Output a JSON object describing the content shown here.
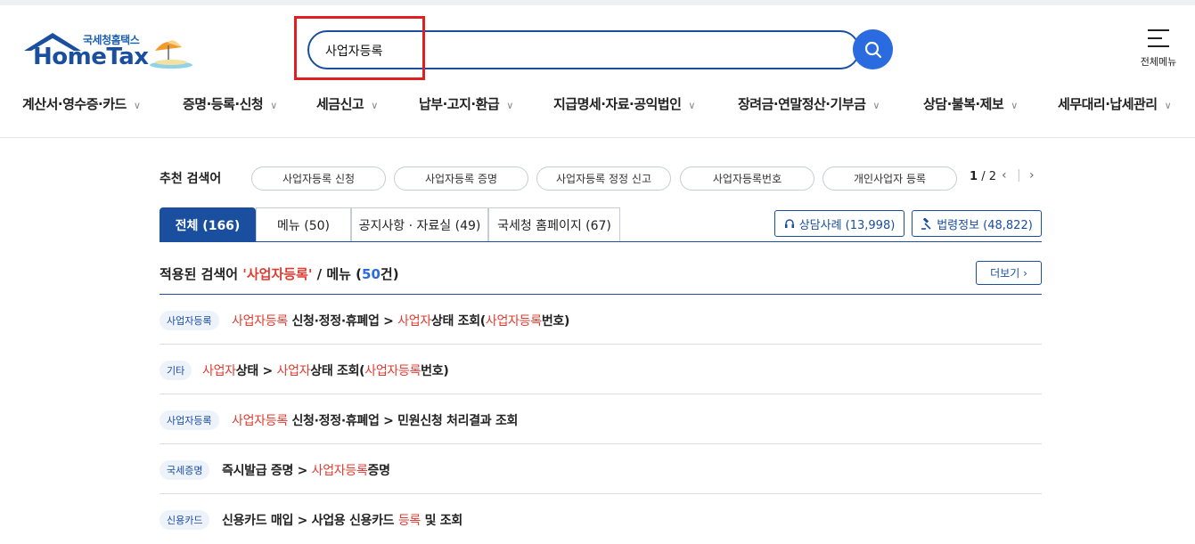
{
  "header": {
    "logo_sub": "국세청홈택스",
    "logo_main": "HomeTax",
    "search_value": "사업자등록",
    "all_menu_label": "전체메뉴"
  },
  "nav": [
    {
      "label": "계산서·영수증·카드"
    },
    {
      "label": "증명·등록·신청"
    },
    {
      "label": "세금신고"
    },
    {
      "label": "납부·고지·환급"
    },
    {
      "label": "지급명세·자료·공익법인"
    },
    {
      "label": "장려금·연말정산·기부금"
    },
    {
      "label": "상담·불복·제보"
    },
    {
      "label": "세무대리·납세관리"
    }
  ],
  "recommend": {
    "label": "추천 검색어",
    "chips": [
      "사업자등록 신청",
      "사업자등록 증명",
      "사업자등록 정정 신고",
      "사업자등록번호",
      "개인사업자 등록"
    ],
    "page_current": "1",
    "page_total": "/ 2"
  },
  "tabs": [
    {
      "label": "전체 (166)"
    },
    {
      "label": "메뉴 (50)"
    },
    {
      "label": "공지사항 · 자료실 (49)"
    },
    {
      "label": "국세청 홈페이지 (67)"
    }
  ],
  "side_buttons": {
    "consult": "상담사례 (13,998)",
    "law": "법령정보 (48,822)"
  },
  "section": {
    "prefix": "적용된 검색어 ",
    "term": "'사업자등록'",
    "middle": " / 메뉴 (",
    "count": "50",
    "suffix": "건)",
    "more": "더보기"
  },
  "results": [
    {
      "tag": "사업자등록",
      "parts": [
        [
          "h",
          "사업자등록"
        ],
        [
          "n",
          " 신청·정정·휴폐업 > "
        ],
        [
          "h",
          "사업자"
        ],
        [
          "n",
          "상태 조회("
        ],
        [
          "h",
          "사업자등록"
        ],
        [
          "n",
          "번호)"
        ]
      ]
    },
    {
      "tag": "기타",
      "parts": [
        [
          "h",
          "사업자"
        ],
        [
          "n",
          "상태 > "
        ],
        [
          "h",
          "사업자"
        ],
        [
          "n",
          "상태 조회("
        ],
        [
          "h",
          "사업자등록"
        ],
        [
          "n",
          "번호)"
        ]
      ]
    },
    {
      "tag": "사업자등록",
      "parts": [
        [
          "h",
          "사업자등록"
        ],
        [
          "n",
          " 신청·정정·휴폐업 > 민원신청 처리결과 조회"
        ]
      ]
    },
    {
      "tag": "국세증명",
      "parts": [
        [
          "n",
          "즉시발급 증명 > "
        ],
        [
          "h",
          "사업자등록"
        ],
        [
          "n",
          "증명"
        ]
      ]
    },
    {
      "tag": "신용카드",
      "parts": [
        [
          "n",
          "신용카드 매입 > 사업용 신용카드 "
        ],
        [
          "h",
          "등록"
        ],
        [
          "n",
          " 및 조회"
        ]
      ]
    }
  ]
}
